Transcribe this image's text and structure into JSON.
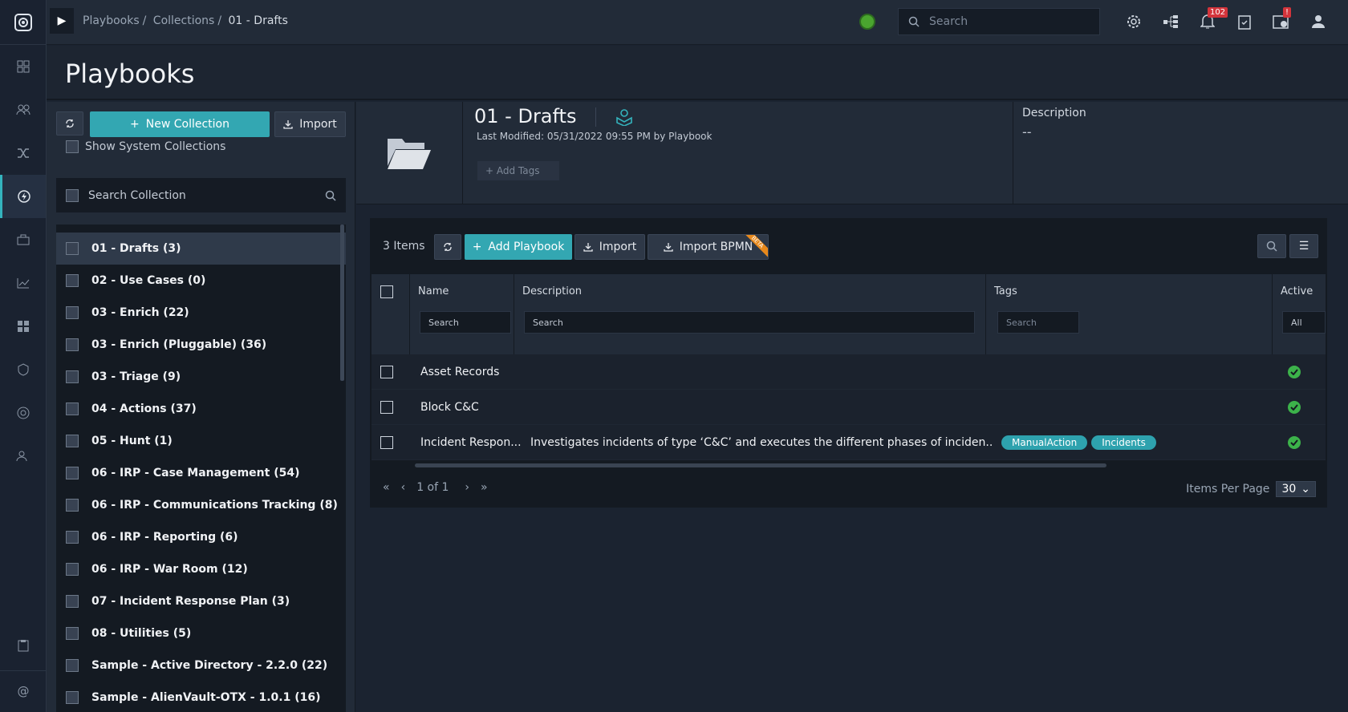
{
  "breadcrumbs": [
    "Playbooks",
    "Collections",
    "01 - Drafts"
  ],
  "top_search_placeholder": "Search",
  "notifications_badge": "102",
  "alert_badge": "!",
  "page_title": "Playbooks",
  "left": {
    "new_collection": "New Collection",
    "import": "Import",
    "show_system": "Show System Collections",
    "search_placeholder": "Search Collection",
    "collections": [
      "01 - Drafts (3)",
      "02 - Use Cases (0)",
      "03 - Enrich (22)",
      "03 - Enrich (Pluggable) (36)",
      "03 - Triage (9)",
      "04 - Actions (37)",
      "05 - Hunt (1)",
      "06 - IRP - Case Management (54)",
      "06 - IRP - Communications Tracking (8)",
      "06 - IRP - Reporting (6)",
      "06 - IRP - War Room (12)",
      "07 - Incident Response Plan (3)",
      "08 - Utilities (5)",
      "Sample - Active Directory - 2.2.0 (22)",
      "Sample - AlienVault-OTX - 1.0.1 (16)"
    ]
  },
  "detail": {
    "name": "01 - Drafts",
    "modified": "Last Modified: 05/31/2022 09:55 PM by Playbook",
    "add_tags": "+ Add Tags",
    "description_label": "Description",
    "description_value": "--"
  },
  "grid": {
    "count": "3 Items",
    "add_playbook": "Add Playbook",
    "import": "Import",
    "import_bpmn": "Import BPMN",
    "beta": "BETA",
    "columns": {
      "name": "Name",
      "description": "Description",
      "tags": "Tags",
      "active": "Active"
    },
    "filters": {
      "name": "Search",
      "description": "Search",
      "tags": "Search",
      "active": "All"
    },
    "rows": [
      {
        "name": "Asset Records",
        "description": "",
        "tags": [],
        "active": true
      },
      {
        "name": "Block C&C",
        "description": "",
        "tags": [],
        "active": true
      },
      {
        "name": "Incident Respon...",
        "description": "Investigates incidents of type ‘C&C’ and executes the different phases of inciden...",
        "tags": [
          "ManualAction",
          "Incidents"
        ],
        "active": true
      }
    ],
    "pager": "1 of 1",
    "items_per_page_label": "Items Per Page",
    "items_per_page": "30"
  }
}
